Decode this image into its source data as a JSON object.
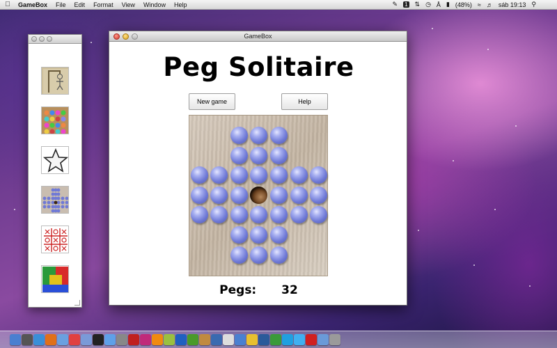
{
  "menubar": {
    "app_name": "GameBox",
    "menus": [
      "File",
      "Edit",
      "Format",
      "View",
      "Window",
      "Help"
    ],
    "battery": "(48%)",
    "clock": "sáb 19:13",
    "status_badge": "1"
  },
  "main_window": {
    "title": "GameBox",
    "game_title": "Peg Solitaire",
    "new_game_label": "New game",
    "help_label": "Help",
    "pegs_label": "Pegs:",
    "pegs_count": "32"
  },
  "palette": {
    "games": [
      "hangman",
      "marbles",
      "star",
      "peg-solitaire",
      "tic-tac-toe",
      "color-blocks"
    ]
  },
  "board": {
    "rows": [
      "..OOO..",
      "..OOO..",
      "OOOOOOO",
      "OOO.OOO",
      "OOOOOOO",
      "..OOO..",
      "..OOO.."
    ]
  },
  "colors": {
    "peg": "#6f79d6",
    "board": "#cfc2b2"
  },
  "dock_icons": [
    "finder",
    "dashboard",
    "safari",
    "firefox",
    "mail",
    "ical",
    "preview",
    "terminal",
    "itunes",
    "system-prefs",
    "flash",
    "indesign",
    "illustrator",
    "fireworks",
    "photoshop",
    "dreamweaver",
    "iphoto",
    "xcode",
    "textedit",
    "finder-2",
    "chrome",
    "thunderbird",
    "facetime",
    "skype",
    "twitter",
    "stop",
    "folder",
    "trash"
  ]
}
